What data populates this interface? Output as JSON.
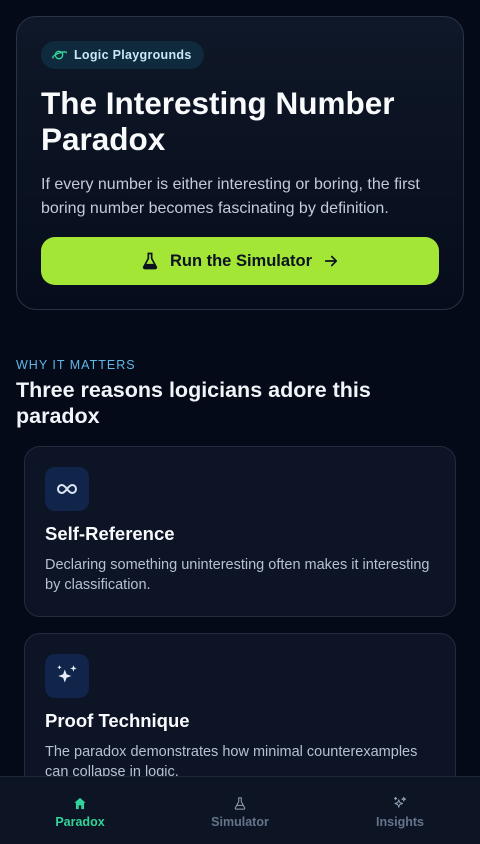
{
  "hero": {
    "badge_label": "Logic Playgrounds",
    "badge_icon": "planet-icon",
    "title": "The Interesting Number Paradox",
    "subtitle": "If every number is either interesting or boring, the first boring number becomes fascinating by definition.",
    "cta_label": "Run the Simulator",
    "cta_icon": "flask-icon",
    "cta_arrow_icon": "arrow-right-icon"
  },
  "section": {
    "eyebrow": "WHY IT MATTERS",
    "title": "Three reasons logicians adore this paradox"
  },
  "cards": [
    {
      "icon": "infinity-icon",
      "title": "Self-Reference",
      "text": "Declaring something uninteresting often makes it interesting by classification."
    },
    {
      "icon": "sparkles-icon",
      "title": "Proof Technique",
      "text": "The paradox demonstrates how minimal counterexamples can collapse in logic."
    }
  ],
  "nav": {
    "items": [
      {
        "label": "Paradox",
        "icon": "home-icon",
        "active": true
      },
      {
        "label": "Simulator",
        "icon": "flask-icon",
        "active": false
      },
      {
        "label": "Insights",
        "icon": "sparkles-icon",
        "active": false
      }
    ]
  },
  "colors": {
    "background": "#050a18",
    "accent_lime": "#a4e635",
    "accent_green": "#34d399",
    "accent_blue": "#5fb7e6",
    "card_bg": "#0c1426"
  }
}
